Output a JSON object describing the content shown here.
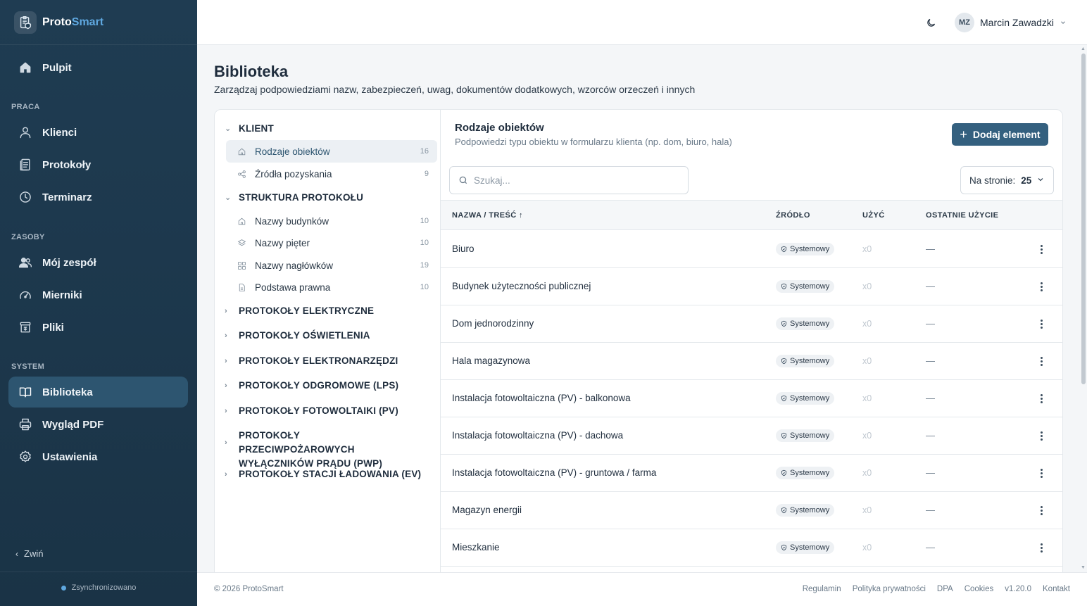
{
  "brand": {
    "part1": "Proto",
    "part2": "Smart"
  },
  "sidebar": {
    "sections": {
      "praca": "PRACA",
      "zasoby": "ZASOBY",
      "system": "SYSTEM"
    },
    "items": {
      "pulpit": "Pulpit",
      "klienci": "Klienci",
      "protokoly": "Protokoły",
      "terminarz": "Terminarz",
      "zespol": "Mój zespół",
      "mierniki": "Mierniki",
      "pliki": "Pliki",
      "biblioteka": "Biblioteka",
      "wyglad": "Wygląd PDF",
      "ustawienia": "Ustawienia"
    },
    "collapse_label": "Zwiń",
    "sync_label": "Zsynchronizowano"
  },
  "topbar": {
    "user_initials": "MZ",
    "user_name": "Marcin Zawadzki"
  },
  "page": {
    "title": "Biblioteka",
    "subtitle": "Zarządzaj podpowiedziami nazw, zabezpieczeń, uwag, dokumentów dodatkowych, wzorców orzeczeń i innych"
  },
  "tree": {
    "klient": {
      "label": "KLIENT",
      "items": [
        {
          "label": "Rodzaje obiektów",
          "count": "16"
        },
        {
          "label": "Źródła pozyskania",
          "count": "9"
        }
      ]
    },
    "struktura": {
      "label": "STRUKTURA PROTOKOŁU",
      "items": [
        {
          "label": "Nazwy budynków",
          "count": "10"
        },
        {
          "label": "Nazwy pięter",
          "count": "10"
        },
        {
          "label": "Nazwy nagłówków",
          "count": "19"
        },
        {
          "label": "Podstawa prawna",
          "count": "10"
        }
      ]
    },
    "collapsed": [
      "PROTOKOŁY ELEKTRYCZNE",
      "PROTOKOŁY OŚWIETLENIA",
      "PROTOKOŁY ELEKTRONARZĘDZI",
      "PROTOKOŁY ODGROMOWE (LPS)",
      "PROTOKOŁY FOTOWOLTAIKI (PV)",
      "PROTOKOŁY PRZECIWPOŻAROWYCH WYŁĄCZNIKÓW PRĄDU (PWP)",
      "PROTOKOŁY STACJI ŁADOWANIA (EV)"
    ]
  },
  "panel": {
    "title": "Rodzaje obiektów",
    "subtitle": "Podpowiedzi typu obiektu w formularzu klienta (np. dom, biuro, hala)",
    "add_button": "Dodaj element",
    "search_placeholder": "Szukaj...",
    "per_page_label": "Na stronie:",
    "per_page_value": "25",
    "columns": {
      "name": "NAZWA / TREŚĆ",
      "source": "ŹRÓDŁO",
      "uses": "UŻYĆ",
      "last": "OSTATNIE UŻYCIE"
    },
    "rows": [
      {
        "name": "Biuro",
        "source": "Systemowy",
        "uses": "x0",
        "last": "—"
      },
      {
        "name": "Budynek użyteczności publicznej",
        "source": "Systemowy",
        "uses": "x0",
        "last": "—"
      },
      {
        "name": "Dom jednorodzinny",
        "source": "Systemowy",
        "uses": "x0",
        "last": "—"
      },
      {
        "name": "Hala magazynowa",
        "source": "Systemowy",
        "uses": "x0",
        "last": "—"
      },
      {
        "name": "Instalacja fotowoltaiczna (PV) - balkonowa",
        "source": "Systemowy",
        "uses": "x0",
        "last": "—"
      },
      {
        "name": "Instalacja fotowoltaiczna (PV) - dachowa",
        "source": "Systemowy",
        "uses": "x0",
        "last": "—"
      },
      {
        "name": "Instalacja fotowoltaiczna (PV) - gruntowa / farma",
        "source": "Systemowy",
        "uses": "x0",
        "last": "—"
      },
      {
        "name": "Magazyn energii",
        "source": "Systemowy",
        "uses": "x0",
        "last": "—"
      },
      {
        "name": "Mieszkanie",
        "source": "Systemowy",
        "uses": "x0",
        "last": "—"
      }
    ]
  },
  "footer": {
    "copyright": "© 2026 ProtoSmart",
    "links": [
      "Regulamin",
      "Polityka prywatności",
      "DPA",
      "Cookies",
      "v1.20.0",
      "Kontakt"
    ]
  }
}
